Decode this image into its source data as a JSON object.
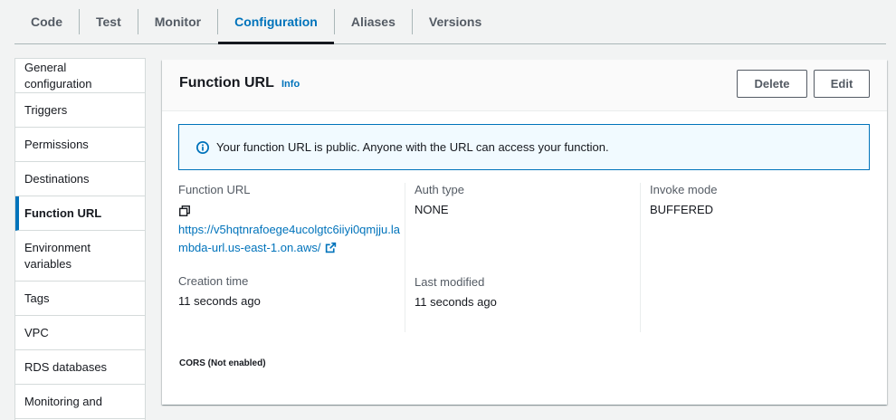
{
  "tabs": [
    {
      "label": "Code"
    },
    {
      "label": "Test"
    },
    {
      "label": "Monitor"
    },
    {
      "label": "Configuration"
    },
    {
      "label": "Aliases"
    },
    {
      "label": "Versions"
    }
  ],
  "sidebar": {
    "items": [
      {
        "label": "General configuration"
      },
      {
        "label": "Triggers"
      },
      {
        "label": "Permissions"
      },
      {
        "label": "Destinations"
      },
      {
        "label": "Function URL"
      },
      {
        "label": "Environment variables"
      },
      {
        "label": "Tags"
      },
      {
        "label": "VPC"
      },
      {
        "label": "RDS databases"
      },
      {
        "label": "Monitoring and"
      }
    ]
  },
  "panel": {
    "title": "Function URL",
    "info": "Info",
    "delete_label": "Delete",
    "edit_label": "Edit",
    "alert": "Your function URL is public. Anyone with the URL can access your function.",
    "function_url_label": "Function URL",
    "function_url": "https://v5hqtnrafoege4ucolgtc6iiyi0qmjju.lambda-url.us-east-1.on.aws/",
    "auth_type_label": "Auth type",
    "auth_type": "NONE",
    "invoke_mode_label": "Invoke mode",
    "invoke_mode": "BUFFERED",
    "creation_time_label": "Creation time",
    "creation_time": "11 seconds ago",
    "last_modified_label": "Last modified",
    "last_modified": "11 seconds ago",
    "cors": "CORS (Not enabled)"
  },
  "colors": {
    "accent": "#0073bb",
    "alert_bg": "#f1faff"
  }
}
